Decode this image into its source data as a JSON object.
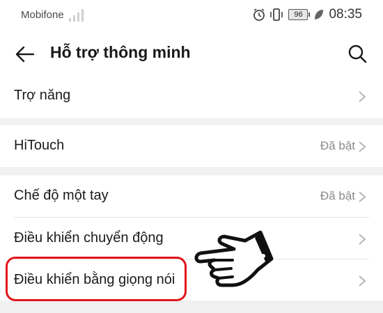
{
  "status_bar": {
    "carrier": "Mobifone",
    "battery": "96",
    "time": "08:35"
  },
  "header": {
    "title": "Hỗ trợ thông minh",
    "back_icon": "arrow-left-icon",
    "search_icon": "search-icon"
  },
  "rows": [
    {
      "label": "Trợ năng",
      "value": ""
    },
    {
      "label": "HiTouch",
      "value": "Đã bật"
    },
    {
      "label": "Chế độ một tay",
      "value": "Đã bật"
    },
    {
      "label": "Điều khiển chuyển động",
      "value": ""
    },
    {
      "label": "Điều khiển bằng giọng nói",
      "value": ""
    }
  ],
  "colors": {
    "highlight": "#e2151b",
    "section_gap": "#f1f1f1",
    "secondary_text": "#8a8a8a"
  }
}
